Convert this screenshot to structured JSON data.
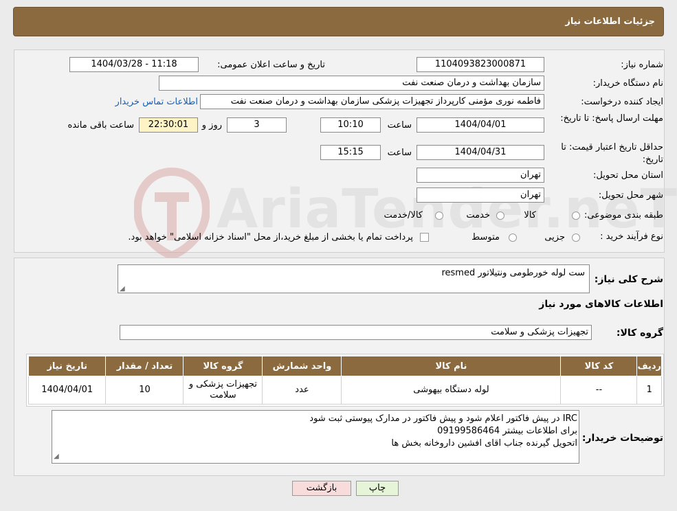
{
  "header": {
    "title": "جزئیات اطلاعات نیاز"
  },
  "fields": {
    "need_number_label": "شماره نیاز:",
    "need_number": "1104093823000871",
    "announce_label": "تاریخ و ساعت اعلان عمومی:",
    "announce_value": "1404/03/28 - 11:18",
    "buyer_org_label": "نام دستگاه خریدار:",
    "buyer_org": "سازمان بهداشت و درمان صنعت نفت",
    "creator_label": "ایجاد کننده درخواست:",
    "creator": "فاطمه نوری مؤمنی کارپرداز تجهیزات پزشکی سازمان بهداشت و درمان صنعت نفت",
    "buyer_contact_link": "اطلاعات تماس خریدار",
    "deadline_label": "مهلت ارسال پاسخ: تا تاریخ:",
    "deadline_date": "1404/04/01",
    "time_label": "ساعت",
    "deadline_time": "10:10",
    "days_count": "3",
    "days_label": "روز و",
    "remaining_time": "22:30:01",
    "remaining_label": "ساعت باقی مانده",
    "validity_label": "حداقل تاریخ اعتبار قیمت: تا تاریخ:",
    "validity_date": "1404/04/31",
    "validity_time": "15:15",
    "province_label": "استان محل تحویل:",
    "province": "تهران",
    "city_label": "شهر محل تحویل:",
    "city": "تهران",
    "category_label": "طبقه بندی موضوعی:",
    "category_options": [
      "کالا",
      "خدمت",
      "کالا/خدمت"
    ],
    "purchase_type_label": "نوع فرآیند خرید :",
    "purchase_options": [
      "جزیی",
      "متوسط"
    ],
    "payment_note": "پرداخت تمام یا بخشی از مبلغ خرید،از محل \"اسناد خزانه اسلامی\" خواهد بود."
  },
  "summary": {
    "description_label": "شرح کلی نیاز:",
    "description": "ست لوله خورطومی ونتیلاتور resmed",
    "goods_info_title": "اطلاعات کالاهای مورد نیاز",
    "goods_group_label": "گروه کالا:",
    "goods_group": "تجهیزات پزشکی و سلامت"
  },
  "table": {
    "headers": [
      "ردیف",
      "کد کالا",
      "نام کالا",
      "واحد شمارش",
      "گروه کالا",
      "تعداد / مقدار",
      "تاریخ نیاز"
    ],
    "rows": [
      [
        "1",
        "--",
        "لوله دستگاه بیهوشی",
        "عدد",
        "تجهیزات پزشکی و سلامت",
        "10",
        "1404/04/01"
      ]
    ]
  },
  "notes": {
    "label": "توضیحات خریدار:",
    "lines": [
      "IRC در پیش فاکتور اعلام شود و پیش فاکتور در مدارک پیوستی ثبت شود",
      "برای اطلاعات بیشتر 09199586464",
      "اتحویل گیرنده جناب اقای افشین داروخانه بخش ها"
    ]
  },
  "buttons": {
    "print": "چاپ",
    "back": "بازگشت"
  },
  "watermark": {
    "text": "AriaTender.neT"
  },
  "colors": {
    "header_bg": "#8a6a3e",
    "link": "#1a5fb4",
    "print_btn": "#e6f5d8",
    "back_btn": "#f8dcdc"
  }
}
